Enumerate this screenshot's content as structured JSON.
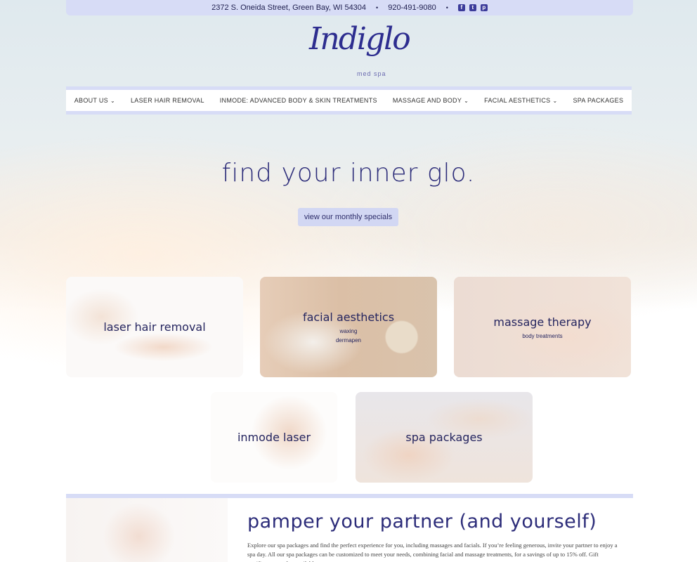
{
  "topbar": {
    "address": "2372 S. Oneida Street, Green Bay, WI 54304",
    "separator": "•",
    "phone": "920-491-9080",
    "social": [
      {
        "icon": "facebook-icon",
        "glyph": "f"
      },
      {
        "icon": "twitter-icon",
        "glyph": "t"
      },
      {
        "icon": "pinterest-icon",
        "glyph": "p"
      }
    ]
  },
  "logo": {
    "name": "Indiglo",
    "tagline": "med spa"
  },
  "nav": {
    "items": [
      {
        "label": "ABOUT US",
        "has_dropdown": true
      },
      {
        "label": "LASER HAIR REMOVAL",
        "has_dropdown": false
      },
      {
        "label": "INMODE: ADVANCED BODY & SKIN TREATMENTS",
        "has_dropdown": false
      },
      {
        "label": "MASSAGE AND BODY",
        "has_dropdown": true
      },
      {
        "label": "FACIAL AESTHETICS",
        "has_dropdown": true
      },
      {
        "label": "SPA PACKAGES",
        "has_dropdown": false
      }
    ],
    "chevron": "⌄"
  },
  "hero": {
    "title": "find your inner glo.",
    "cta": "view our monthly specials"
  },
  "cards": {
    "laser": {
      "title": "laser hair removal"
    },
    "facial": {
      "title": "facial aesthetics",
      "links": [
        "waxing",
        "dermapen"
      ]
    },
    "massage": {
      "title": "massage therapy",
      "links": [
        "body treatments"
      ]
    },
    "inmode": {
      "title": "inmode laser"
    },
    "spa": {
      "title": "spa packages"
    }
  },
  "promo": {
    "heading": "pamper your partner (and yourself)",
    "body": "Explore our spa packages and find the perfect experience for you, including massages and facials. If you’re feeling generous, invite your partner to enjoy a spa day. All our spa packages can be customized to meet your needs, combining facial and massage treatments, for a savings of up to 15% off. Gift certificates are also available."
  },
  "colors": {
    "accent": "#d7dcf6",
    "brand": "#2d2d8f"
  }
}
